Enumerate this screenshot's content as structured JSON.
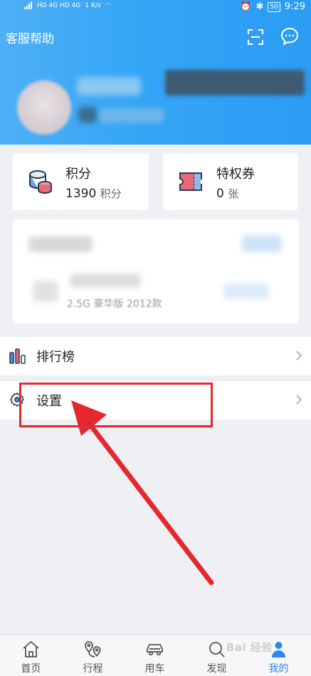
{
  "status_bar": {
    "network_left": "HD 4G HD 4G",
    "speed": "1 K/s",
    "battery": "50",
    "time": "9:29"
  },
  "header": {
    "help_label": "客服帮助"
  },
  "cards": {
    "points": {
      "title": "积分",
      "value": "1390",
      "unit": "积分"
    },
    "coupons": {
      "title": "特权券",
      "value": "0",
      "unit": "张"
    }
  },
  "vehicle": {
    "model_text": "2.5G 豪华版 2012款"
  },
  "menu": {
    "ranking_label": "排行榜",
    "settings_label": "设置"
  },
  "tabs": [
    {
      "label": "首页",
      "icon": "home-icon"
    },
    {
      "label": "行程",
      "icon": "route-icon"
    },
    {
      "label": "用车",
      "icon": "car-icon"
    },
    {
      "label": "发现",
      "icon": "discover-icon"
    },
    {
      "label": "我的",
      "icon": "profile-icon"
    }
  ],
  "watermark": "Bai 经验",
  "colors": {
    "header_blue": "#36a6f6",
    "highlight_red": "#e5282e",
    "active_tab": "#2a87f0"
  }
}
